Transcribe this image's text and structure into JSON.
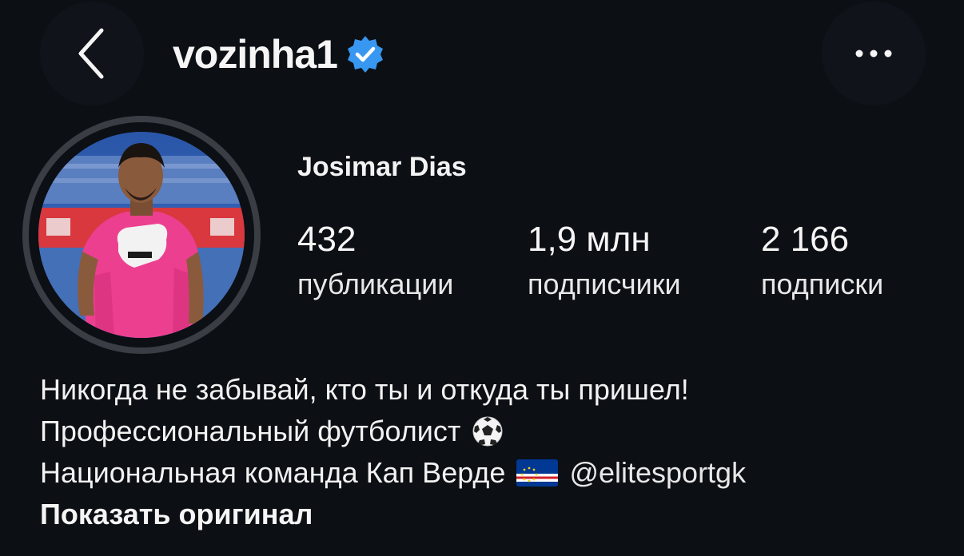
{
  "header": {
    "back_icon": "chevron-left-icon",
    "username": "vozinha1",
    "verified_icon": "verified-badge-icon",
    "verified_color": "#3897f0",
    "more_icon": "more-horizontal-icon"
  },
  "profile": {
    "avatar": "profile-photo",
    "full_name": "Josimar Dias",
    "stats": [
      {
        "value": "432",
        "label": "публикации"
      },
      {
        "value": "1,9 млн",
        "label": "подписчики"
      },
      {
        "value": "2 166",
        "label": "подписки"
      }
    ]
  },
  "bio": {
    "line1": "Никогда не забывай, кто ты и откуда ты пришел!",
    "line2": "Профессиональный футболист",
    "line2_icon": "soccer-ball-icon",
    "line3": "Национальная команда Кап Верде",
    "line3_icon": "cape-verde-flag-icon",
    "mention": "@elitesportgk",
    "show_original": "Показать оригинал"
  }
}
